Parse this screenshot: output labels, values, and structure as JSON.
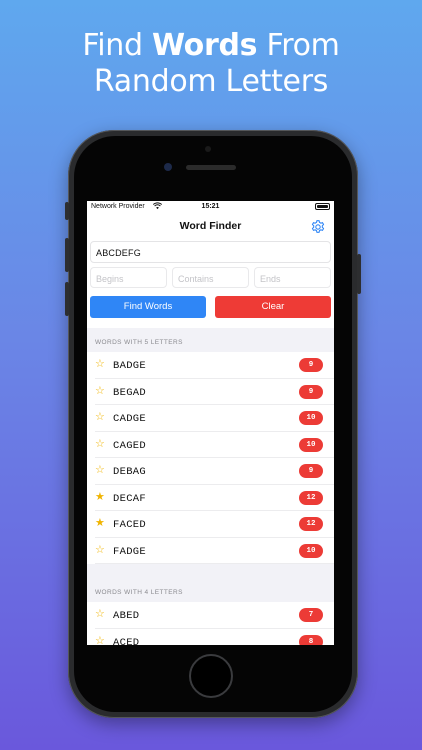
{
  "headline": {
    "part1": "Find ",
    "bold": "Words",
    "part2": " From",
    "line2": "Random Letters"
  },
  "status_bar": {
    "carrier": "Network Provider",
    "time": "15:21"
  },
  "navbar": {
    "title": "Word Finder",
    "settings_icon": "gear-icon"
  },
  "search": {
    "value": "ABCDEFG"
  },
  "filters": {
    "begins_placeholder": "Begins",
    "contains_placeholder": "Contains",
    "ends_placeholder": "Ends"
  },
  "buttons": {
    "find_label": "Find Words",
    "clear_label": "Clear"
  },
  "colors": {
    "find_button": "#2f86f6",
    "clear_button": "#ee3b36",
    "score_badge": "#ec3b36",
    "star": "#f0b400"
  },
  "sections": [
    {
      "header": "WORDS WITH 5 LETTERS",
      "rows": [
        {
          "word": "BADGE",
          "score": "9",
          "favorite": false
        },
        {
          "word": "BEGAD",
          "score": "9",
          "favorite": false
        },
        {
          "word": "CADGE",
          "score": "10",
          "favorite": false
        },
        {
          "word": "CAGED",
          "score": "10",
          "favorite": false
        },
        {
          "word": "DEBAG",
          "score": "9",
          "favorite": false
        },
        {
          "word": "DECAF",
          "score": "12",
          "favorite": true
        },
        {
          "word": "FACED",
          "score": "12",
          "favorite": true
        },
        {
          "word": "FADGE",
          "score": "10",
          "favorite": false
        }
      ]
    },
    {
      "header": "WORDS WITH 4 LETTERS",
      "rows": [
        {
          "word": "ABED",
          "score": "7",
          "favorite": false
        },
        {
          "word": "ACED",
          "score": "8",
          "favorite": false
        }
      ]
    }
  ]
}
